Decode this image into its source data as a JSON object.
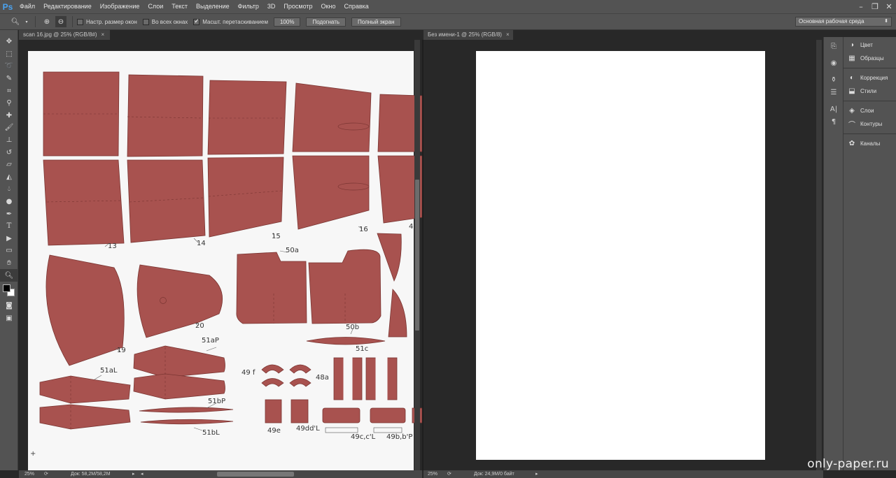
{
  "app": {
    "logo": "Ps"
  },
  "menu": [
    "Файл",
    "Редактирование",
    "Изображение",
    "Слои",
    "Текст",
    "Выделение",
    "Фильтр",
    "3D",
    "Просмотр",
    "Окно",
    "Справка"
  ],
  "options": {
    "resize_windows": "Настр. размер окон",
    "all_windows": "Во всех окнах",
    "scrubby_zoom": "Масшт. перетаскиванием",
    "btn_100": "100%",
    "btn_fit": "Подогнать",
    "btn_fullscreen": "Полный экран",
    "workspace": "Основная рабочая среда"
  },
  "doc1": {
    "tab": "scan 16.jpg @ 25% (RGB/8#)",
    "zoom": "25%",
    "status": "Док: 58,2M/58,2M",
    "labels": [
      "13",
      "14",
      "15",
      "16",
      "4",
      "50a",
      "20",
      "19",
      "50b",
      "51aP",
      "51aL",
      "51c",
      "49 f",
      "48a",
      "51bP",
      "51bL",
      "49e",
      "49dd'L",
      "49c,c'L",
      "49b,b'P"
    ]
  },
  "doc2": {
    "tab": "Без имени-1 @ 25% (RGB/8)",
    "zoom": "25%",
    "status": "Док: 24,9M/0 байт"
  },
  "panels": [
    {
      "label": "Цвет"
    },
    {
      "label": "Образцы"
    },
    {
      "label": "Коррекция"
    },
    {
      "label": "Стили"
    },
    {
      "label": "Слои"
    },
    {
      "label": "Контуры"
    },
    {
      "label": "Каналы"
    }
  ],
  "watermark": "only-paper.ru",
  "colors": {
    "part_fill": "#a8524f",
    "part_edge": "#7a3532",
    "chrome": "#535353",
    "pasteboard": "#282828"
  }
}
